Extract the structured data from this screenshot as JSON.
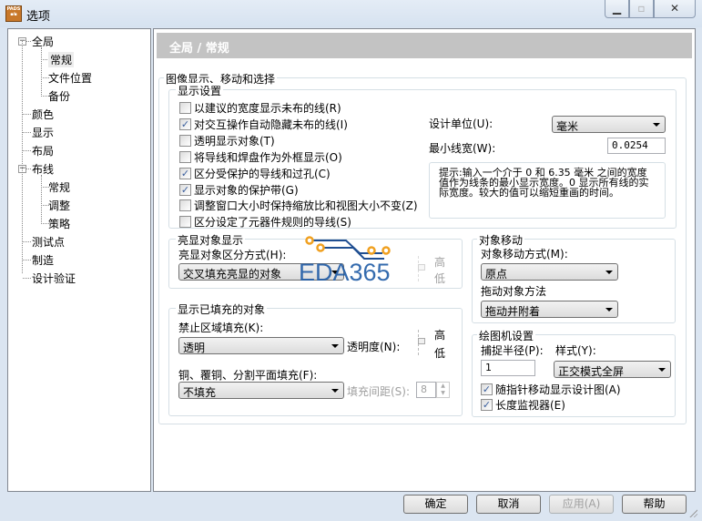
{
  "window": {
    "title": "选项",
    "icon_text": "PADS"
  },
  "tree": {
    "items": [
      {
        "label": "全局",
        "expanded": true
      },
      {
        "label": "常规",
        "selected": true
      },
      {
        "label": "文件位置"
      },
      {
        "label": "备份"
      },
      {
        "label": "颜色"
      },
      {
        "label": "显示"
      },
      {
        "label": "布局"
      },
      {
        "label": "布线",
        "expanded": true
      },
      {
        "label": "常规"
      },
      {
        "label": "调整"
      },
      {
        "label": "策略"
      },
      {
        "label": "测试点"
      },
      {
        "label": "制造"
      },
      {
        "label": "设计验证"
      }
    ]
  },
  "banner": "全局 / 常规",
  "main_group": "图像显示、移动和选择",
  "display": {
    "title": "显示设置",
    "checks": [
      {
        "label": "以建议的宽度显示未布的线(R)",
        "checked": false
      },
      {
        "label": "对交互操作自动隐藏未布的线(I)",
        "checked": true
      },
      {
        "label": "透明显示对象(T)",
        "checked": false
      },
      {
        "label": "将导线和焊盘作为外框显示(O)",
        "checked": false
      },
      {
        "label": "区分受保护的导线和过孔(C)",
        "checked": true
      },
      {
        "label": "显示对象的保护带(G)",
        "checked": true
      },
      {
        "label": "调整窗口大小时保持缩放比和视图大小不变(Z)",
        "checked": false
      },
      {
        "label": "区分设定了元器件规则的导线(S)",
        "checked": false
      }
    ],
    "units_label": "设计单位(U):",
    "units_value": "毫米",
    "minwidth_label": "最小线宽(W):",
    "minwidth_value": "0.0254",
    "hint": "提示:输入一个介于 0 和 6.35 毫米 之间的宽度值作为线条的最小显示宽度。0 显示所有线的实际宽度。较大的值可以缩短重画的时间。"
  },
  "highlight": {
    "title": "亮显对象显示",
    "mode_label": "亮显对象区分方式(H):",
    "mode_value": "交叉填充亮显的对象",
    "high": "高",
    "low": "低"
  },
  "filled": {
    "title": "显示已填充的对象",
    "keepout_label": "禁止区域填充(K):",
    "keepout_value": "透明",
    "transp_label": "透明度(N):",
    "high": "高",
    "low": "低",
    "copper_label": "铜、覆铜、分割平面填充(F):",
    "copper_value": "不填充",
    "spacing_label": "填充间距(S):",
    "spacing_value": "8"
  },
  "move": {
    "title": "对象移动",
    "mode_label": "对象移动方式(M):",
    "mode_value": "原点",
    "drag_label": "拖动对象方法",
    "drag_value": "拖动并附着"
  },
  "plotter": {
    "title": "绘图机设置",
    "snap_label": "捕捉半径(P):",
    "snap_value": "1",
    "style_label": "样式(Y):",
    "style_value": "正交模式全屏",
    "checks": [
      {
        "label": "随指针移动显示设计图(A)",
        "checked": true
      },
      {
        "label": "长度监视器(E)",
        "checked": true
      }
    ]
  },
  "buttons": {
    "ok": "确定",
    "cancel": "取消",
    "apply": "应用(A)",
    "help": "帮助"
  },
  "watermark": "EDA365"
}
